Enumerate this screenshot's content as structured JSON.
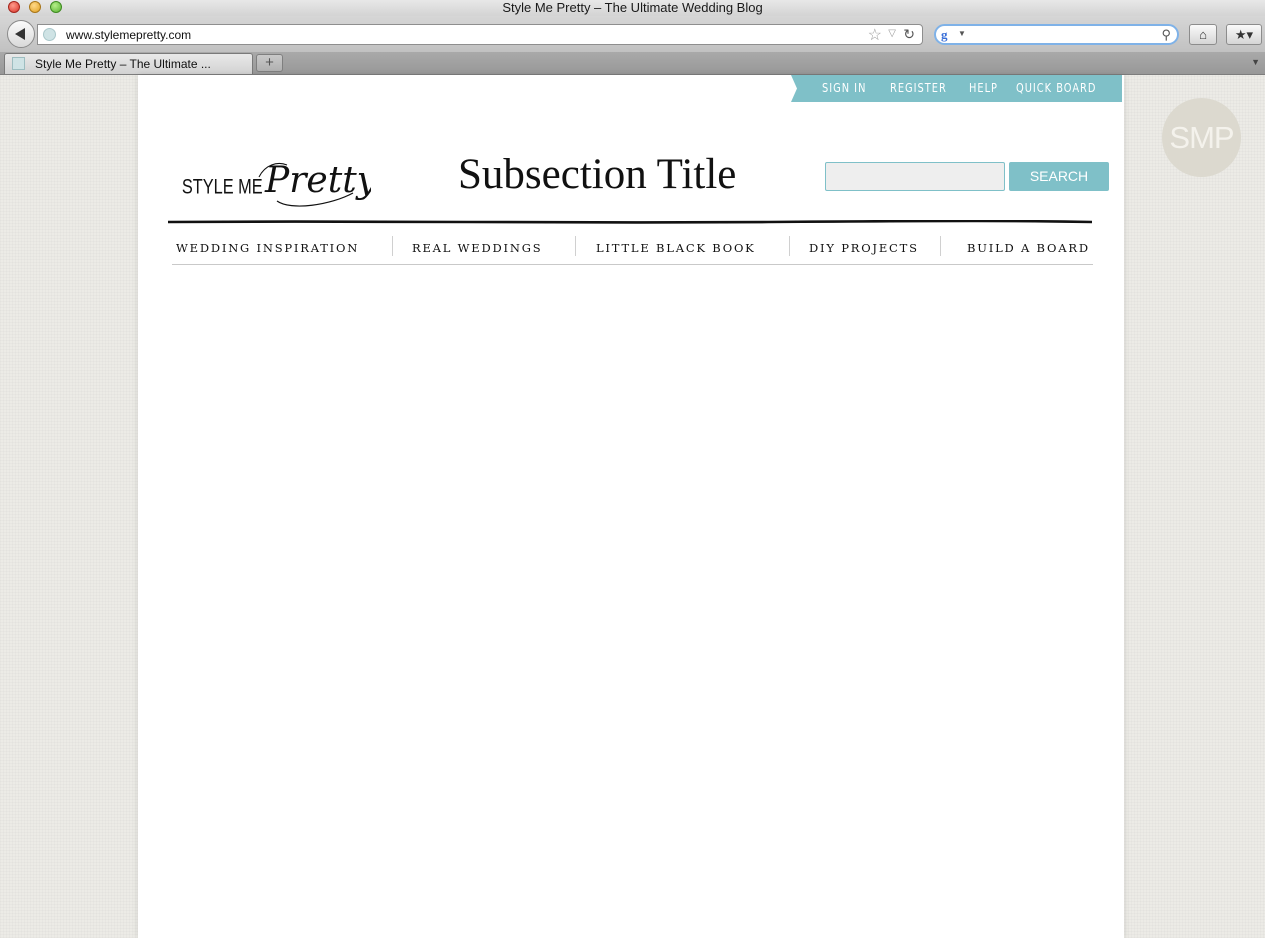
{
  "window": {
    "title": "Style Me Pretty – The Ultimate Wedding Blog"
  },
  "toolbar": {
    "url": "www.stylemepretty.com",
    "search_value": ""
  },
  "tabs": [
    {
      "label": "Style Me Pretty – The Ultimate ..."
    }
  ],
  "site": {
    "logo_text_small": "STYLE ME",
    "logo_text_script": "Pretty",
    "badge_text": "SMP",
    "top_nav": [
      "SIGN IN",
      "REGISTER",
      "HELP",
      "QUICK BOARD"
    ],
    "page_title": "Subsection Title",
    "search": {
      "value": "",
      "button_label": "SEARCH"
    },
    "main_nav": [
      "WEDDING INSPIRATION",
      "REAL WEDDINGS",
      "LITTLE BLACK BOOK",
      "DIY PROJECTS",
      "BUILD A BOARD"
    ]
  },
  "colors": {
    "accent": "#7fc0c8",
    "page_background": "#ecebe6",
    "badge": "#dcd9cf",
    "text": "#111111"
  },
  "icons": {
    "back": "back-arrow-icon",
    "site": "site-identity-icon",
    "bookmark_star": "star-icon",
    "reload": "reload-icon",
    "search_engine": "google-icon",
    "search": "magnifier-icon",
    "home": "home-icon",
    "bookmarks": "bookmarks-icon",
    "new_tab": "plus-icon"
  }
}
